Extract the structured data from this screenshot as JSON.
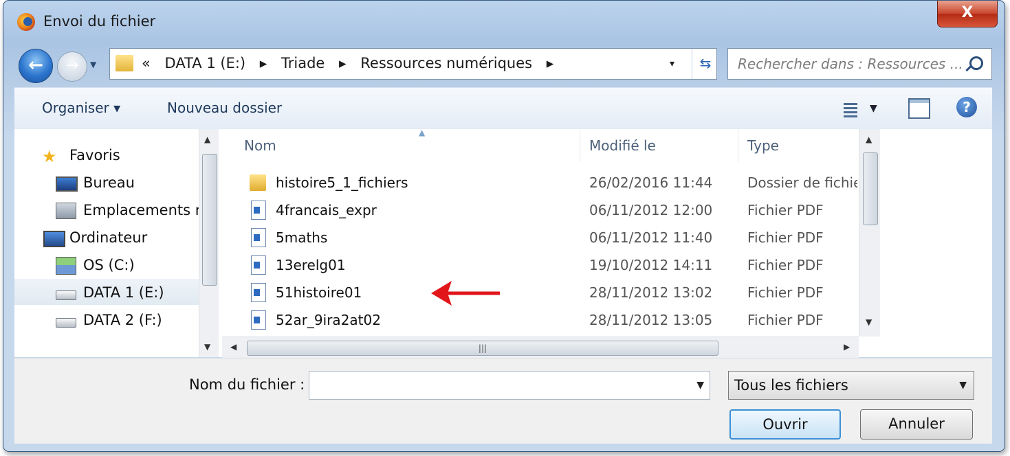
{
  "window": {
    "title": "Envoi du fichier",
    "close_glyph": "X"
  },
  "address": {
    "overflow": "«",
    "crumbs": [
      "DATA 1 (E:)",
      "Triade",
      "Ressources numériques"
    ],
    "separator": "▸",
    "dropdown": "▾"
  },
  "search": {
    "placeholder": "Rechercher dans : Ressources ..."
  },
  "toolbar": {
    "organize_label": "Organiser ▾",
    "new_folder_label": "Nouveau dossier"
  },
  "sidebar": {
    "items": [
      {
        "label": "Favoris",
        "icon": "star-icon"
      },
      {
        "label": "Bureau",
        "icon": "desktop-icon"
      },
      {
        "label": "Emplacements r",
        "icon": "network-locations-icon"
      },
      {
        "label": "Ordinateur",
        "icon": "computer-icon"
      },
      {
        "label": "OS (C:)",
        "icon": "system-drive-icon"
      },
      {
        "label": "DATA 1 (E:)",
        "icon": "drive-icon",
        "selected": true
      },
      {
        "label": "DATA 2 (F:)",
        "icon": "drive-icon"
      }
    ]
  },
  "files": {
    "columns": {
      "name": "Nom",
      "modified": "Modifié le",
      "type": "Type"
    },
    "rows": [
      {
        "name": "histoire5_1_fichiers",
        "modified": "26/02/2016 11:44",
        "type": "Dossier de fichie",
        "icon": "folder-icon"
      },
      {
        "name": "4francais_expr",
        "modified": "06/11/2012 12:00",
        "type": "Fichier PDF",
        "icon": "document-icon"
      },
      {
        "name": "5maths",
        "modified": "06/11/2012 11:40",
        "type": "Fichier PDF",
        "icon": "document-icon"
      },
      {
        "name": "13erelg01",
        "modified": "19/10/2012 14:11",
        "type": "Fichier PDF",
        "icon": "document-icon"
      },
      {
        "name": "51histoire01",
        "modified": "28/11/2012 13:02",
        "type": "Fichier PDF",
        "icon": "document-icon"
      },
      {
        "name": "52ar_9ira2at02",
        "modified": "28/11/2012 13:05",
        "type": "Fichier PDF",
        "icon": "document-icon"
      }
    ]
  },
  "bottom": {
    "filename_label": "Nom du fichier :",
    "filename_value": "",
    "filetype_value": "Tous les fichiers",
    "open_label": "Ouvrir",
    "cancel_label": "Annuler"
  },
  "colors": {
    "annotation_arrow": "#e0161b",
    "accent": "#3c8fd5"
  }
}
